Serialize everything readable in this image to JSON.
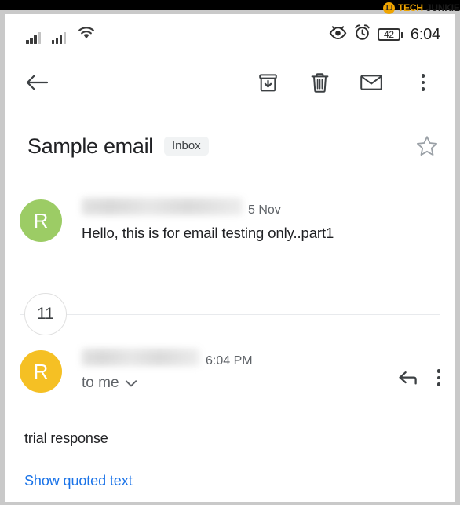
{
  "watermark": {
    "badge_letters": "TJ",
    "text_primary": "TECH",
    "text_secondary": "JUNKIE",
    "color_primary": "#f0a500",
    "color_secondary": "#1a1a1a"
  },
  "status_bar": {
    "signal_1": "signal-bars-icon",
    "signal_2": "signal-bars-icon",
    "wifi": "wifi-icon",
    "eye": "eye-icon",
    "alarm": "alarm-clock-icon",
    "battery_level": "42",
    "time": "6:04"
  },
  "toolbar": {
    "back": "back-arrow-icon",
    "archive": "archive-icon",
    "delete": "trash-icon",
    "mark_unread": "envelope-icon",
    "overflow": "more-vertical-icon"
  },
  "subject": {
    "title": "Sample email",
    "label_chip": "Inbox",
    "star": "star-outline-icon"
  },
  "messages": [
    {
      "avatar_letter": "R",
      "avatar_color": "#9ccc65",
      "sender_redacted": true,
      "sender_blur_width": 205,
      "date": "5 Nov",
      "preview": "Hello, this is for email testing only..part1"
    },
    {
      "avatar_letter": "R",
      "avatar_color": "#f5c024",
      "sender_redacted": true,
      "sender_blur_width": 150,
      "date": "6:04 PM",
      "recipient": "to me",
      "recipient_chevron": "chevron-down-icon",
      "reply": "reply-arrow-icon",
      "overflow": "more-vertical-icon"
    }
  ],
  "collapsed": {
    "count": "11"
  },
  "body": {
    "text": "trial response",
    "show_quoted_label": "Show quoted text",
    "link_color": "#1a73e8"
  }
}
